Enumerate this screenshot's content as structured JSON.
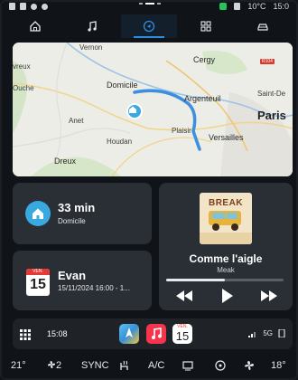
{
  "status_bar": {
    "temperature": "10°C",
    "time": "15:0"
  },
  "nav": {
    "tabs": [
      {
        "id": "home",
        "icon": "home-icon"
      },
      {
        "id": "music",
        "icon": "music-note-icon"
      },
      {
        "id": "navigation",
        "icon": "navigation-icon",
        "active": true
      },
      {
        "id": "apps",
        "icon": "apps-icon"
      },
      {
        "id": "vehicle",
        "icon": "car-icon"
      }
    ],
    "accent": "#2b8de3"
  },
  "map": {
    "labels": {
      "vernon": "Vernon",
      "cergy": "Cergy",
      "route": "R104",
      "evreux": "vreux",
      "domicile": "Domicile",
      "argenteuil": "Argenteuil",
      "saint_denis": "Saint-De",
      "ouche": "Ouche",
      "paris": "Paris",
      "anet": "Anet",
      "plaisir": "Plaisir",
      "versailles": "Versailles",
      "houdan": "Houdan",
      "dreux": "Dreux"
    },
    "route_color": "#3d8fe0"
  },
  "trip": {
    "duration": "33 min",
    "destination": "Domicile"
  },
  "calendar": {
    "month_abbr": "VEN.",
    "day": "15",
    "title": "Evan",
    "subtitle": "15/11/2024 16:00 - 1..."
  },
  "music": {
    "album_text": "BREAK",
    "song": "Comme l'aigle",
    "artist": "Meak",
    "progress_fraction": 0.5
  },
  "dock": {
    "time": "15:08",
    "apps": [
      "maps-app-icon",
      "music-app-icon",
      "calendar-app-icon"
    ],
    "calendar_app_month": "VEN.",
    "calendar_app_day": "15",
    "network": "5G"
  },
  "climate": {
    "left_temp": "21°",
    "left_temp_unit": "°C",
    "fan_level": "2",
    "sync": "SYNC",
    "ac": "A/C",
    "right_temp": "18°"
  }
}
